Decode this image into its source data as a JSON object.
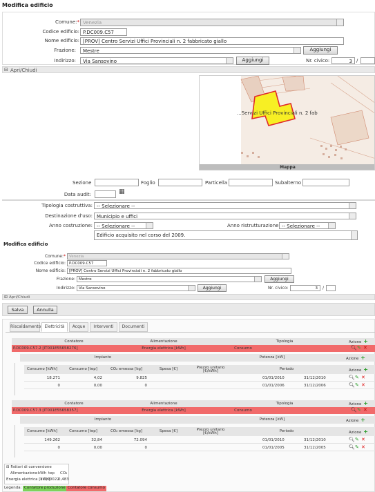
{
  "top_form": {
    "title": "Modifica edificio",
    "comune_label": "Comune:",
    "comune_value": "Venezia",
    "codice_label": "Codice edificio:",
    "codice_value": "P.DC009.C57",
    "nome_label": "Nome edificio:",
    "nome_value": "[PROV] Centro Servizi Uffici Provinciali n. 2 fabbricato giallo",
    "frazione_label": "Frazione:",
    "frazione_value": "Mestre",
    "aggiungi": "Aggiungi",
    "indirizzo_label": "Indirizzo:",
    "indirizzo_value": "Via Sansovino",
    "civico_label": "Nr. civico:",
    "civico_value": "3",
    "civico_sep": "/",
    "toggle": "Apri/Chiudi",
    "map_text": "...Servizi Uffici Provinciali n. 2 fab",
    "map_caption": "Mappa",
    "sezione_label": "Sezione",
    "foglio_label": "Foglio",
    "particella_label": "Particella",
    "subalterno_label": "Subalterno",
    "data_audit_label": "Data audit:",
    "tipologia_label": "Tipologia costruttiva:",
    "tipologia_value": "-- Selezionare --",
    "destinazione_label": "Destinazione d'uso:",
    "destinazione_value": "Municipio e uffici",
    "anno_costr_label": "Anno costruzione:",
    "anno_costr_value": "-- Selezionare --",
    "anno_ristr_label": "Anno ristrutturazione:",
    "anno_ristr_value": "-- Selezionare --",
    "note_value": "Edificio acquisito nel corso del 2009."
  },
  "form2": {
    "title": "Modifica edificio",
    "comune_label": "Comune:",
    "comune_value": "Venezia",
    "codice_label": "Codice edificio:",
    "codice_value": "P.DC009.C57",
    "nome_label": "Nome edificio:",
    "nome_value": "[PROV] Centro Servizi Uffici Provinciali n. 2 fabbricato giallo",
    "frazione_label": "Frazione:",
    "frazione_value": "Mestre",
    "aggiungi": "Aggiungi",
    "indirizzo_label": "Indirizzo:",
    "indirizzo_value": "Via Sansovino",
    "civico_label": "Nr. civico:",
    "civico_value": "3",
    "civico_sep": "/",
    "toggle": "Apri/Chiudi",
    "salva": "Salva",
    "annulla": "Annulla"
  },
  "tabs": [
    "Riscaldamento",
    "Elettricità",
    "Acque",
    "Interventi",
    "Documenti"
  ],
  "table_headers": {
    "contatore": "Contatore",
    "alimentazione": "Alimentazione",
    "tipologia": "Tipologia",
    "azione": "Azione",
    "impianto": "Impianto",
    "potenza": "Potenza [kW]",
    "consumo_kwh": "Consumo [kWh]",
    "consumo_tep": "Consumo [tep]",
    "co2": "CO₂ emessa [kg]",
    "spesa": "Spesa [€]",
    "prezzo": "Prezzo unitario [€/kWh]",
    "periodo": "Periodo"
  },
  "meters": [
    {
      "contatore": "P.DC009.C57.2 [IT001E55658276]",
      "alimentazione": "Energia elettrica [kWh]",
      "tipologia": "Consumo",
      "rows": [
        {
          "kwh": "18.271",
          "tep": "4,02",
          "co2": "9.825",
          "spesa": "",
          "prezzo": "",
          "da": "01/01/2010",
          "a": "31/12/2010"
        },
        {
          "kwh": "0",
          "tep": "0,00",
          "co2": "0",
          "spesa": "",
          "prezzo": "",
          "da": "01/01/2006",
          "a": "31/12/2006"
        }
      ]
    },
    {
      "contatore": "P.DC009.C57.3 [IT001E55658357]",
      "alimentazione": "Energia elettrica [kWh]",
      "tipologia": "Consumo",
      "rows": [
        {
          "kwh": "149.262",
          "tep": "32,84",
          "co2": "72.094",
          "spesa": "",
          "prezzo": "",
          "da": "01/01/2010",
          "a": "31/12/2010"
        },
        {
          "kwh": "0",
          "tep": "0,00",
          "co2": "0",
          "spesa": "",
          "prezzo": "",
          "da": "01/01/2005",
          "a": "31/12/2005"
        }
      ]
    }
  ],
  "fattori": {
    "title": "Fattori di conversione",
    "headers": [
      "Alimentazione",
      "kWh",
      "tep",
      "CO₂"
    ],
    "row": [
      "Energia elettrica [kWh]",
      "1",
      "0,00022",
      "0,483"
    ]
  },
  "legenda": {
    "label": "Legenda:",
    "produzione": "Contatore produzione",
    "consumo": "Contatore consumo"
  },
  "colors": {
    "red_row": "#f16a6a",
    "produzione_bg": "#7dd35a",
    "consumo_bg": "#f16a6a",
    "map_building": "#f7ef24"
  }
}
